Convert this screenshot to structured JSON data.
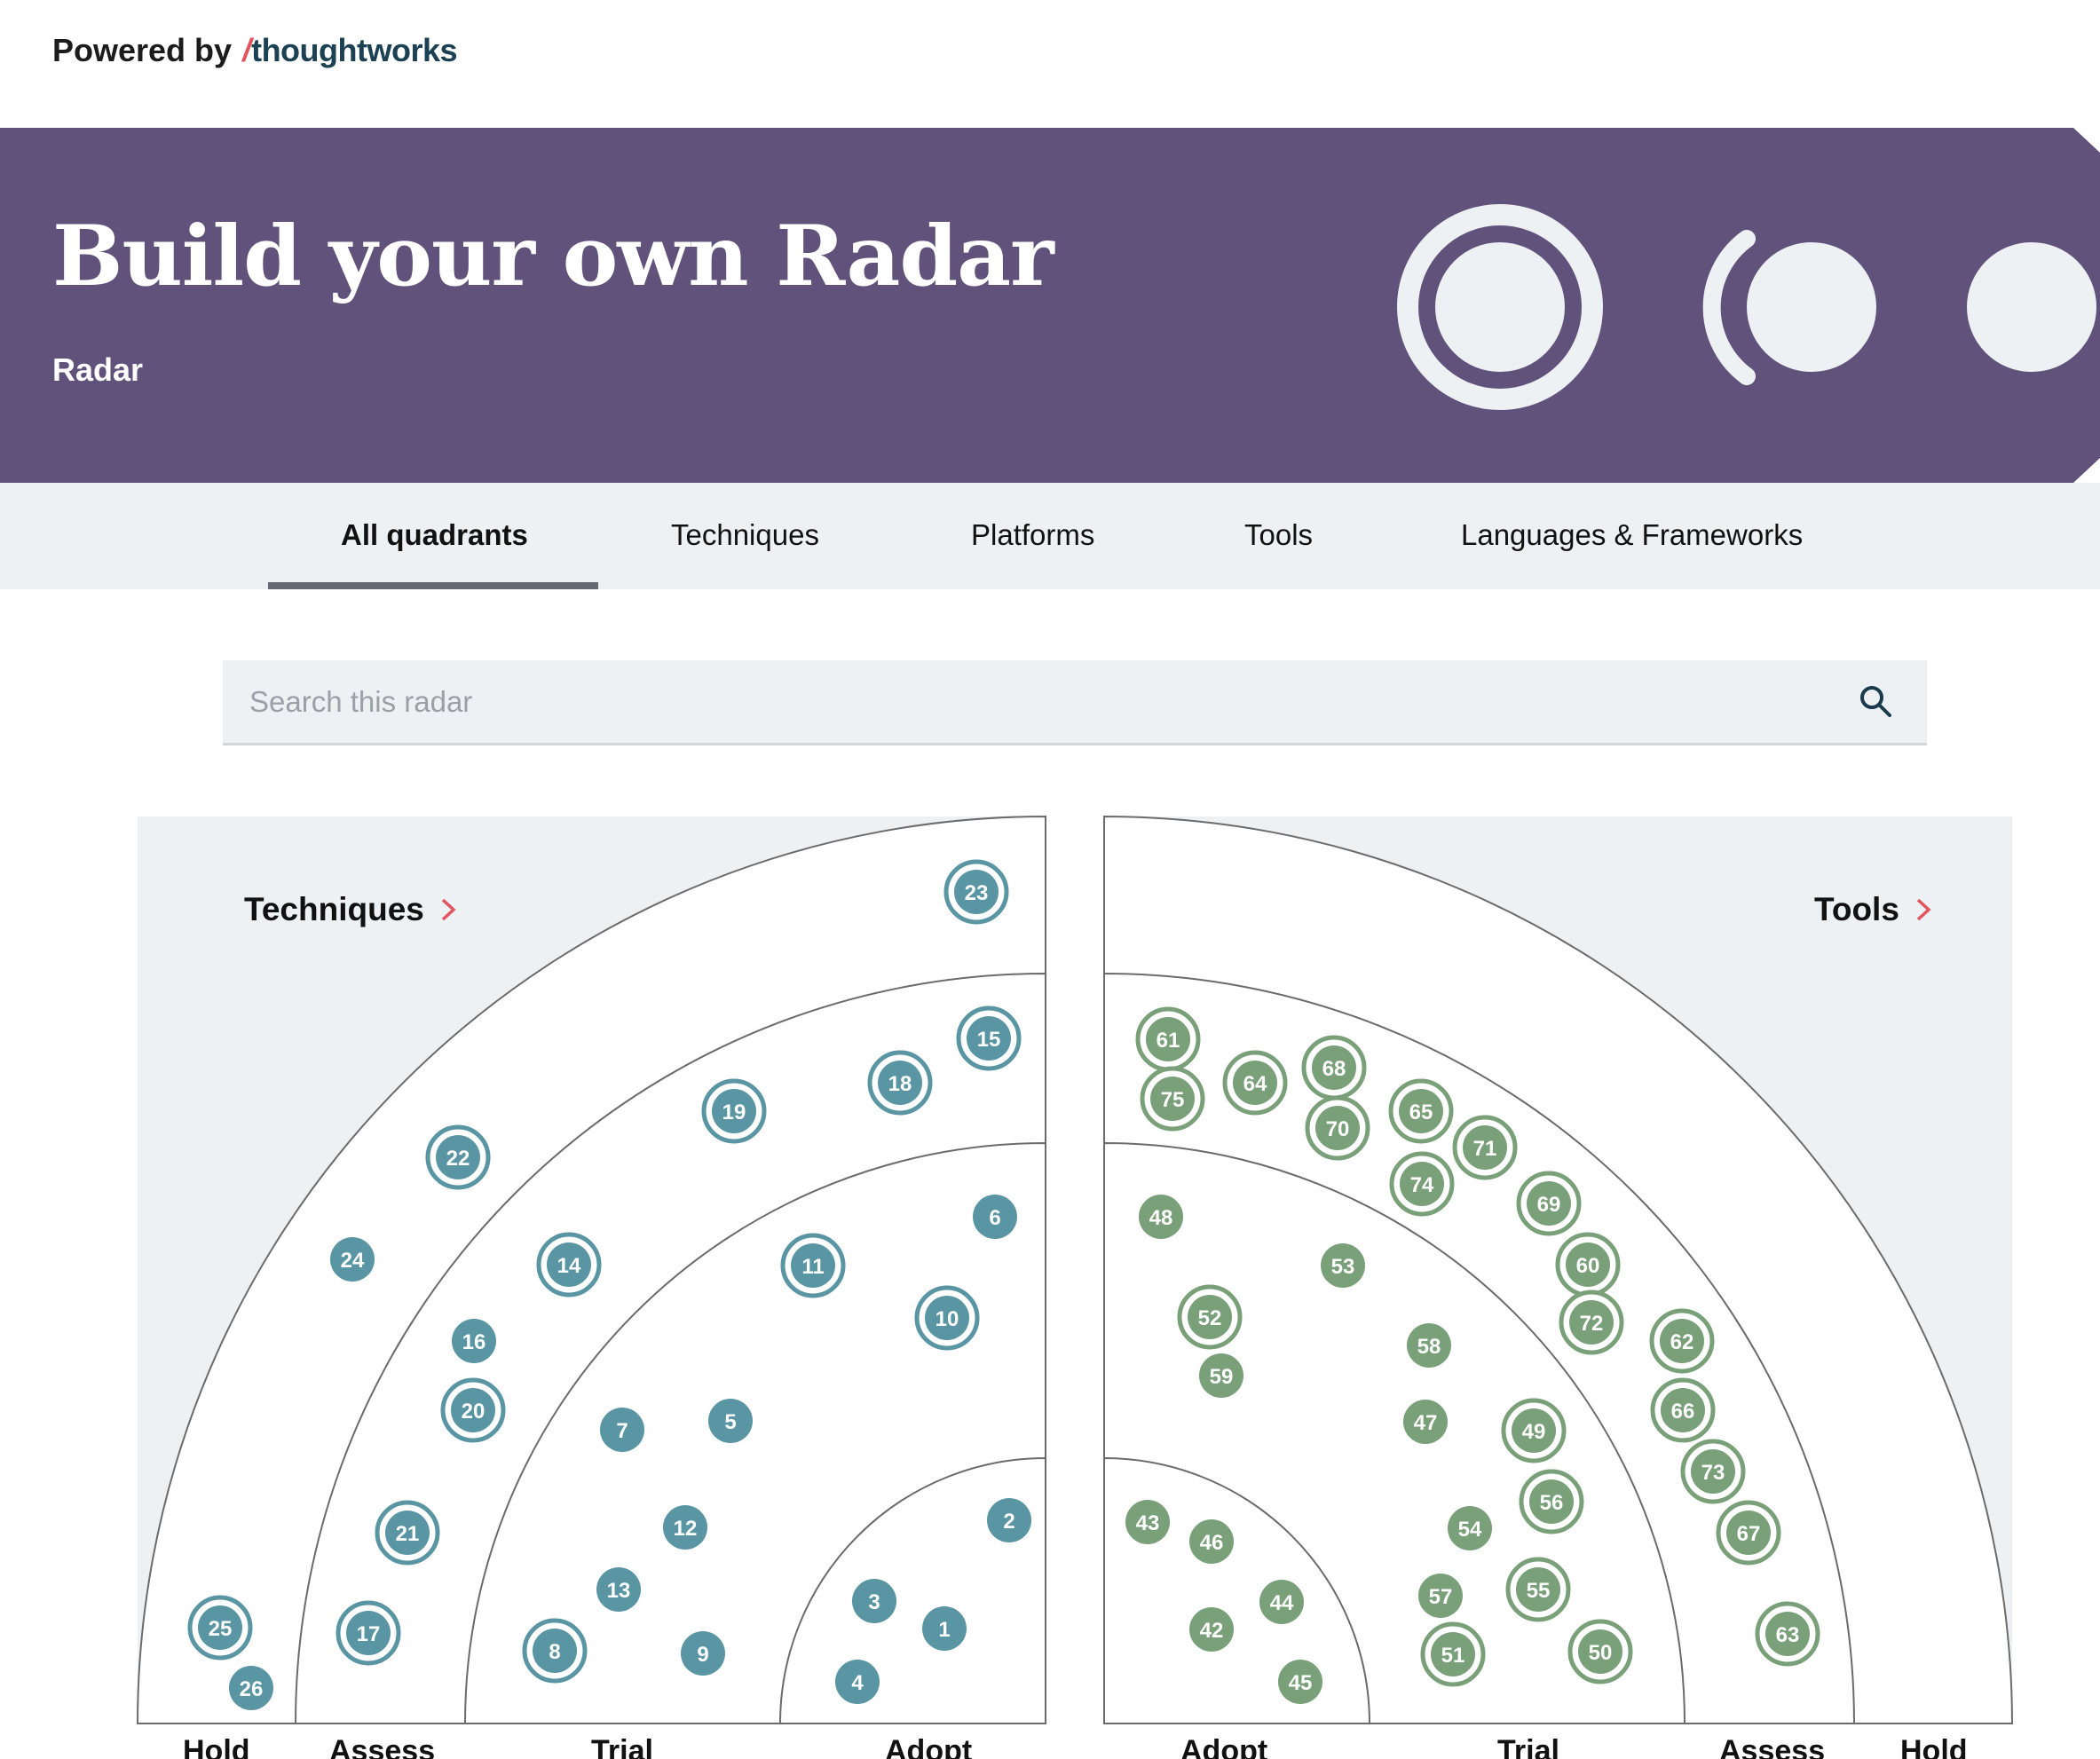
{
  "header": {
    "powered_by": "Powered by",
    "brand_slash": "/",
    "brand": "thoughtworks"
  },
  "hero": {
    "title": "Build your own Radar",
    "subtitle": "Radar"
  },
  "tabs": [
    {
      "label": "All quadrants",
      "active": true
    },
    {
      "label": "Techniques",
      "active": false
    },
    {
      "label": "Platforms",
      "active": false
    },
    {
      "label": "Tools",
      "active": false
    },
    {
      "label": "Languages & Frameworks",
      "active": false
    }
  ],
  "search": {
    "placeholder": "Search this radar",
    "icon": "search-icon"
  },
  "quadrants": {
    "left": {
      "label": "Techniques",
      "color": "#5995a3",
      "icon": "chevron-right-icon"
    },
    "right": {
      "label": "Tools",
      "color": "#7aa07a",
      "icon": "chevron-right-icon"
    }
  },
  "rings": [
    "Adopt",
    "Trial",
    "Assess",
    "Hold"
  ],
  "colors": {
    "hero_bg": "#61527c",
    "tab_bg": "#edf1f3",
    "quad_bg": "#edf1f3",
    "technique_blip": "#5995a3",
    "tool_blip": "#7aa07a",
    "chevron": "#e2545f"
  },
  "blips": {
    "techniques": [
      {
        "id": "23",
        "style": "ring"
      },
      {
        "id": "15",
        "style": "ring"
      },
      {
        "id": "18",
        "style": "ring"
      },
      {
        "id": "19",
        "style": "ring"
      },
      {
        "id": "22",
        "style": "ring"
      },
      {
        "id": "6",
        "style": "dot"
      },
      {
        "id": "24",
        "style": "dot"
      },
      {
        "id": "14",
        "style": "ring"
      },
      {
        "id": "11",
        "style": "ring"
      },
      {
        "id": "10",
        "style": "ring"
      },
      {
        "id": "16",
        "style": "dot"
      },
      {
        "id": "20",
        "style": "ring"
      },
      {
        "id": "7",
        "style": "dot"
      },
      {
        "id": "5",
        "style": "dot"
      },
      {
        "id": "12",
        "style": "dot"
      },
      {
        "id": "2",
        "style": "dot"
      },
      {
        "id": "21",
        "style": "ring"
      },
      {
        "id": "13",
        "style": "dot"
      },
      {
        "id": "3",
        "style": "dot"
      },
      {
        "id": "1",
        "style": "dot"
      },
      {
        "id": "25",
        "style": "ring"
      },
      {
        "id": "17",
        "style": "ring"
      },
      {
        "id": "8",
        "style": "ring"
      },
      {
        "id": "9",
        "style": "dot"
      },
      {
        "id": "26",
        "style": "dot"
      },
      {
        "id": "4",
        "style": "dot"
      }
    ],
    "tools": [
      {
        "id": "61",
        "style": "ring"
      },
      {
        "id": "75",
        "style": "ring"
      },
      {
        "id": "64",
        "style": "ring"
      },
      {
        "id": "68",
        "style": "ring"
      },
      {
        "id": "70",
        "style": "ring"
      },
      {
        "id": "65",
        "style": "ring"
      },
      {
        "id": "71",
        "style": "ring"
      },
      {
        "id": "74",
        "style": "ring"
      },
      {
        "id": "69",
        "style": "ring"
      },
      {
        "id": "48",
        "style": "dot"
      },
      {
        "id": "53",
        "style": "dot"
      },
      {
        "id": "60",
        "style": "ring"
      },
      {
        "id": "52",
        "style": "ring"
      },
      {
        "id": "72",
        "style": "ring"
      },
      {
        "id": "62",
        "style": "ring"
      },
      {
        "id": "58",
        "style": "dot"
      },
      {
        "id": "59",
        "style": "dot"
      },
      {
        "id": "66",
        "style": "ring"
      },
      {
        "id": "47",
        "style": "dot"
      },
      {
        "id": "49",
        "style": "ring"
      },
      {
        "id": "73",
        "style": "ring"
      },
      {
        "id": "56",
        "style": "ring"
      },
      {
        "id": "43",
        "style": "dot"
      },
      {
        "id": "46",
        "style": "dot"
      },
      {
        "id": "54",
        "style": "dot"
      },
      {
        "id": "67",
        "style": "ring"
      },
      {
        "id": "44",
        "style": "dot"
      },
      {
        "id": "55",
        "style": "ring"
      },
      {
        "id": "57",
        "style": "dot"
      },
      {
        "id": "42",
        "style": "dot"
      },
      {
        "id": "63",
        "style": "ring"
      },
      {
        "id": "51",
        "style": "ring"
      },
      {
        "id": "50",
        "style": "ring"
      },
      {
        "id": "45",
        "style": "dot"
      }
    ]
  }
}
